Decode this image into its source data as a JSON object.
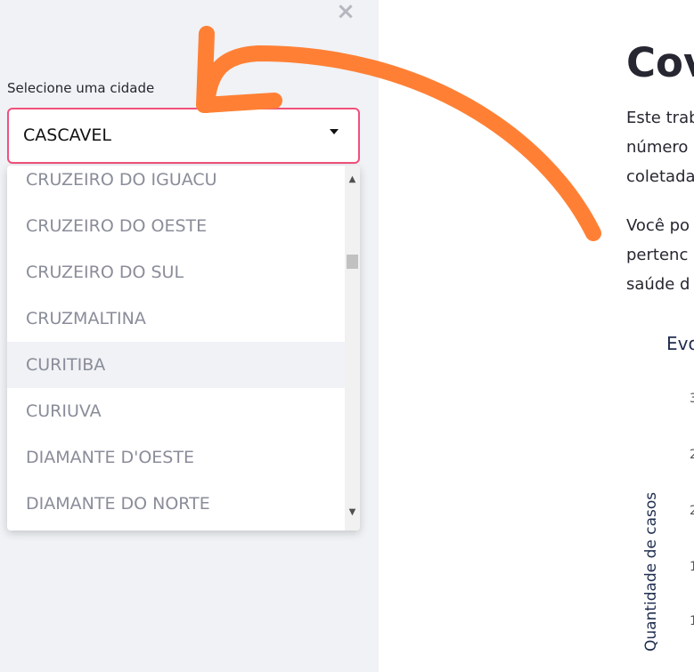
{
  "sidebar": {
    "close_icon": "×",
    "select_label": "Selecione uma cidade",
    "selected_value": "CASCAVEL",
    "options": [
      "CRUZEIRO DO IGUACU",
      "CRUZEIRO DO OESTE",
      "CRUZEIRO DO SUL",
      "CRUZMALTINA",
      "CURITIBA",
      "CURIUVA",
      "DIAMANTE D'OESTE",
      "DIAMANTE DO NORTE"
    ],
    "highlighted_option": "CURITIBA"
  },
  "main": {
    "title": "Cov",
    "paragraph1": [
      "Este trab",
      "número",
      "coletada"
    ],
    "paragraph2": [
      "Você po",
      "pertenc",
      "saúde d"
    ],
    "chart_title": "Evo",
    "y_axis_label": "Quantidade de casos"
  },
  "colors": {
    "sidebar_bg": "#f0f2f6",
    "select_border": "#f0517a",
    "annotation_arrow": "#ff8035",
    "option_text": "#8a8d99"
  },
  "icons": {
    "close": "close-icon",
    "caret": "caret-down-icon",
    "scroll_up": "scroll-up-icon",
    "scroll_down": "scroll-down-icon"
  }
}
